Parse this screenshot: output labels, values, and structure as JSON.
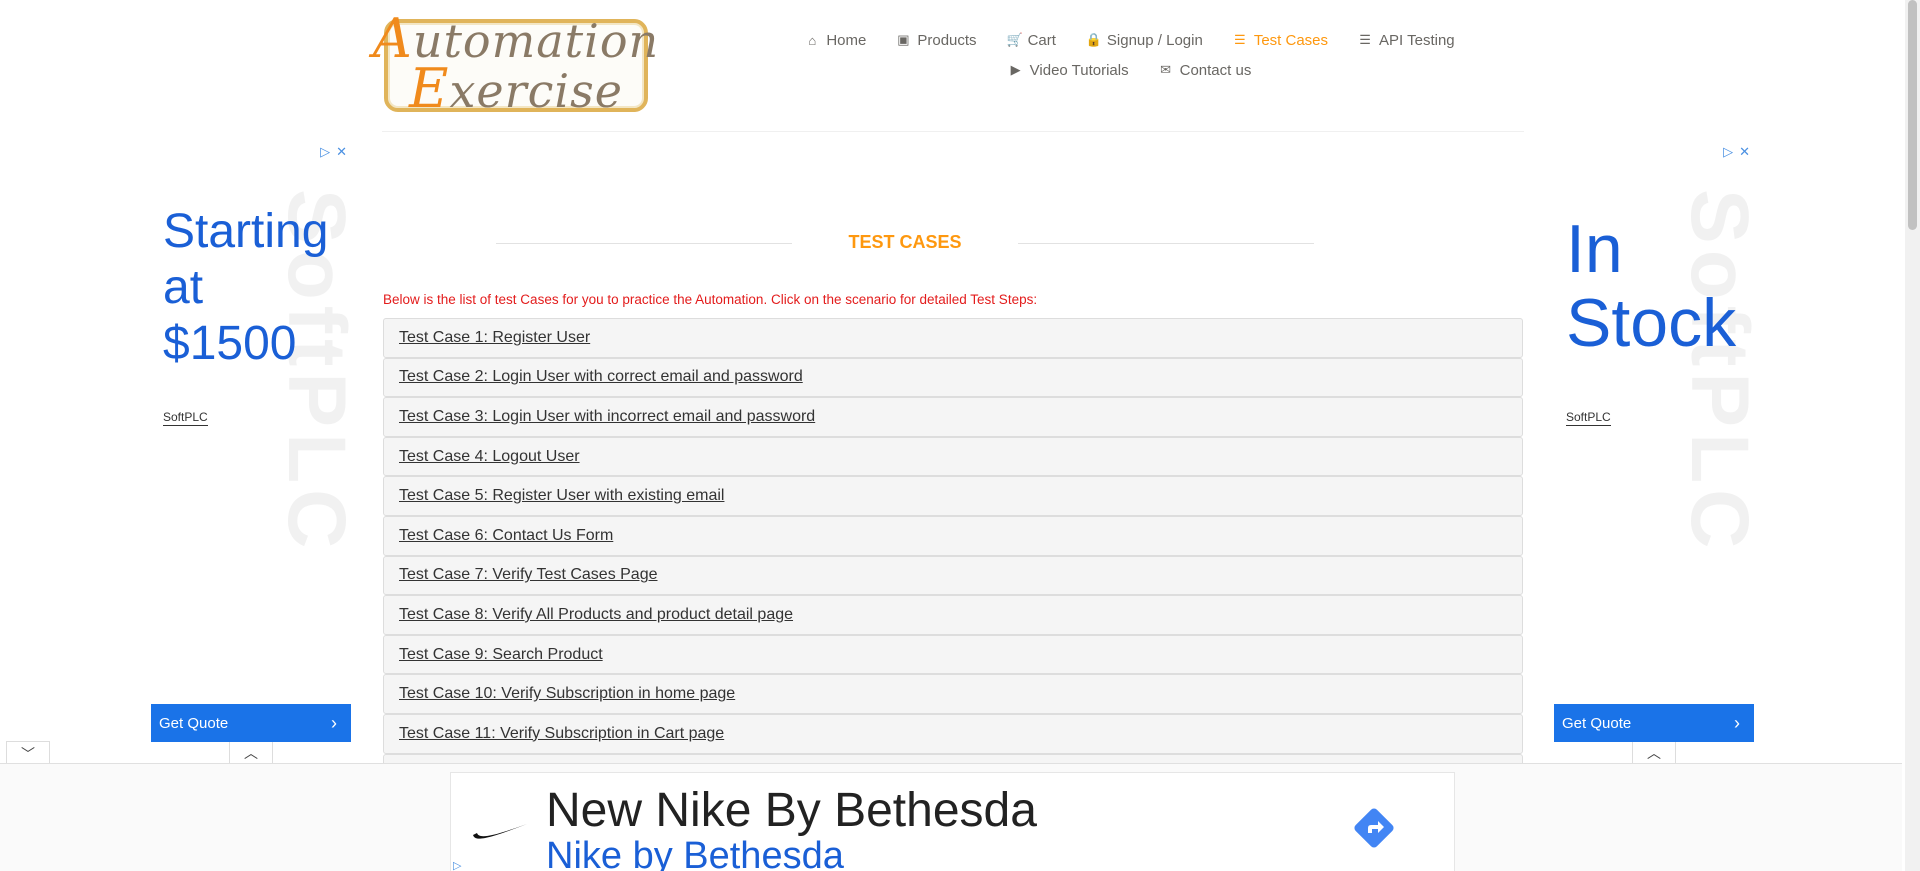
{
  "logo": {
    "line1_cap": "A",
    "line1_rest": "utomation",
    "line2_cap": "E",
    "line2_rest": "xercise"
  },
  "nav": {
    "row1": [
      {
        "icon": "home-icon",
        "glyph": "⌂",
        "label": "Home"
      },
      {
        "icon": "briefcase-icon",
        "glyph": "▣",
        "label": "Products"
      },
      {
        "icon": "cart-icon",
        "glyph": "🛒",
        "label": "Cart"
      },
      {
        "icon": "lock-icon",
        "glyph": "🔒",
        "label": "Signup / Login"
      },
      {
        "icon": "list-icon",
        "glyph": "☰",
        "label": "Test Cases"
      },
      {
        "icon": "list-icon",
        "glyph": "☰",
        "label": "API Testing"
      }
    ],
    "row2": [
      {
        "icon": "youtube-icon",
        "glyph": "▶",
        "label": "Video Tutorials"
      },
      {
        "icon": "envelope-icon",
        "glyph": "✉",
        "label": "Contact us"
      }
    ],
    "active_color": "#fe980f"
  },
  "ads": {
    "left": {
      "headline_lines": [
        "Starting",
        "at",
        "$1500"
      ],
      "brand": "SoftPLC",
      "cta": "Get Quote",
      "watermark": "SoftPLC"
    },
    "right": {
      "headline_lines": [
        "In",
        "Stock"
      ],
      "brand": "SoftPLC",
      "cta": "Get Quote",
      "watermark": "SoftPLC"
    },
    "bottom": {
      "headline": "New Nike By Bethesda",
      "subline": "Nike by Bethesda"
    }
  },
  "main": {
    "title": "TEST CASES",
    "intro": "Below is the list of test Cases for you to practice the Automation. Click on the scenario for detailed Test Steps:",
    "test_cases": [
      "Test Case 1: Register User",
      "Test Case 2: Login User with correct email and password",
      "Test Case 3: Login User with incorrect email and password",
      "Test Case 4: Logout User",
      "Test Case 5: Register User with existing email",
      "Test Case 6: Contact Us Form",
      "Test Case 7: Verify Test Cases Page",
      "Test Case 8: Verify All Products and product detail page",
      "Test Case 9: Search Product",
      "Test Case 10: Verify Subscription in home page",
      "Test Case 11: Verify Subscription in Cart page"
    ]
  },
  "colors": {
    "accent": "#fe980f",
    "intro_red": "#e31c1c",
    "ad_blue": "#1a73e8"
  }
}
